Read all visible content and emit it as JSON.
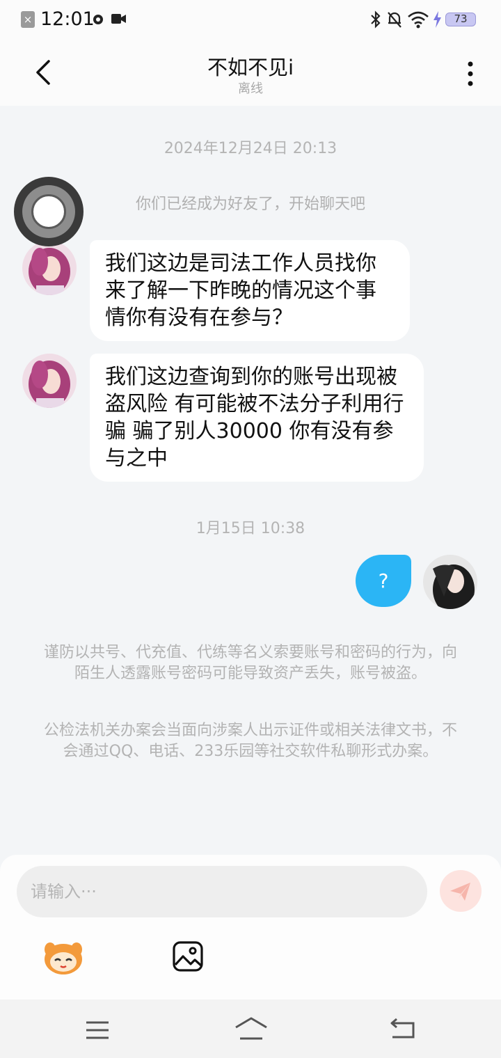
{
  "status_bar": {
    "time": "12:01",
    "battery": "73"
  },
  "header": {
    "title": "不如不见i",
    "status": "离线"
  },
  "messages": {
    "timestamp_1": "2024年12月24日 20:13",
    "system_friend": "你们已经成为好友了，开始聊天吧",
    "incoming_1": "我们这边是司法工作人员找你来了解一下昨晚的情况这个事情你有没有在参与？",
    "incoming_2": "我们这边查询到你的账号出现被盗风险 有可能被不法分子利用行骗 骗了别人30000 你有没有参与之中",
    "timestamp_2": "1月15日 10:38",
    "outgoing_1": "?"
  },
  "notices": {
    "warning_1": "谨防以共号、代充值、代练等名义索要账号和密码的行为，向陌生人透露账号密码可能导致资产丢失，账号被盗。",
    "warning_2": "公检法机关办案会当面向涉案人出示证件或相关法律文书，不会通过QQ、电话、233乐园等社交软件私聊形式办案。"
  },
  "input": {
    "placeholder": "请输入···"
  },
  "colors": {
    "outgoing_bubble": "#2bb5f5",
    "send_button": "#fde3df",
    "background": "#f3f5f7"
  },
  "icons": {
    "back": "back-arrow-icon",
    "more": "more-vertical-icon",
    "send": "send-plane-icon",
    "emoji": "mascot-emoji-icon",
    "image": "image-icon",
    "nav_menu": "menu-icon",
    "nav_home": "home-icon",
    "nav_back": "back-nav-icon"
  }
}
